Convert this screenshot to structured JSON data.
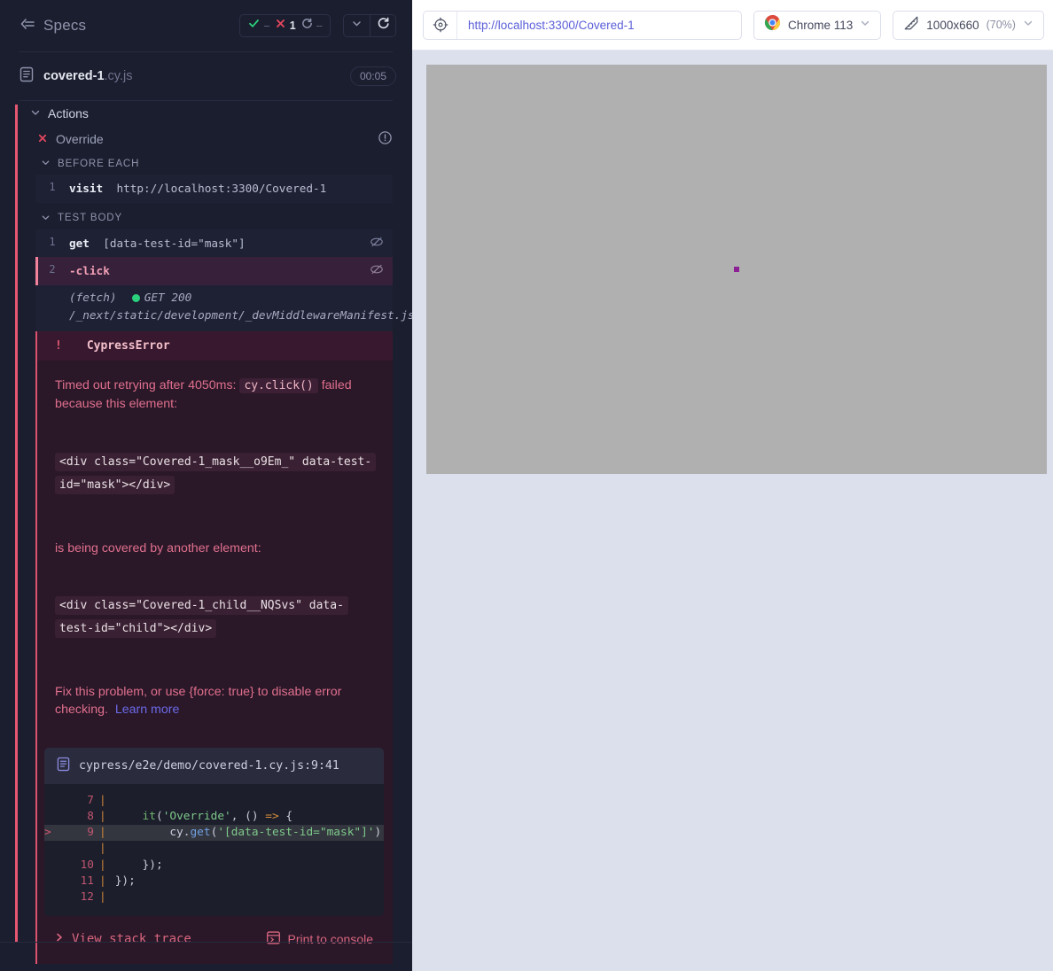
{
  "reporter": {
    "header": {
      "specs_label": "Specs",
      "back_icon": "collapse-left-icon",
      "stats": [
        {
          "icon": "check-icon",
          "name": "passed",
          "value": "--"
        },
        {
          "icon": "x-icon",
          "name": "failed",
          "value": "1"
        },
        {
          "icon": "pending-icon",
          "name": "pending",
          "value": "--"
        }
      ],
      "controls": [
        {
          "icon": "chevron-down-icon",
          "name": "toggle-specs-list"
        },
        {
          "icon": "reload-icon",
          "name": "rerun-tests"
        }
      ]
    },
    "spec": {
      "file_icon": "file-document-icon",
      "name": "covered-1",
      "extension": ".cy.js",
      "duration": "00:05"
    },
    "suite": {
      "title": "Actions",
      "chevron": "chevron-down-icon"
    },
    "test": {
      "title": "Override",
      "status_icon": "x-icon",
      "info_icon": "exclamation-circle-icon"
    },
    "hooks": [
      {
        "title": "BEFORE EACH",
        "chevron": "chevron-down-icon",
        "commands": [
          {
            "num": "1",
            "method": "visit",
            "arg": "http://localhost:3300/Covered-1",
            "hidden_icon": false,
            "active": false
          }
        ]
      },
      {
        "title": "TEST BODY",
        "chevron": "chevron-down-icon",
        "commands": [
          {
            "num": "1",
            "method": "get",
            "arg": "[data-test-id=\"mask\"]",
            "hidden_icon": true,
            "active": false
          },
          {
            "num": "2",
            "method": "-click",
            "arg": "",
            "hidden_icon": true,
            "active": true
          }
        ],
        "route": {
          "label": "(fetch)",
          "status_dot": "green",
          "status": "GET 200",
          "url": "/_next/static/development/_devMiddlewareManifest.json"
        }
      }
    ],
    "error": {
      "bang": "!",
      "name": "CypressError",
      "message_prefix": "Timed out retrying after 4050ms:",
      "message_code": "cy.click()",
      "message_suffix": "failed because this element:",
      "element_html": "<div class=\"Covered-1_mask__o9Em_\" data-test-id=\"mask\"></div>",
      "middle_text": "is being covered by another element:",
      "covering_html": "<div class=\"Covered-1_child__NQSvs\" data-test-id=\"child\"></div>",
      "fix_text": "Fix this problem, or use {force: true} to disable error checking.",
      "learn_more": "Learn more",
      "codeframe": {
        "file_icon": "file-document-icon",
        "path": "cypress/e2e/demo/covered-1.cy.js:9:41",
        "lines": [
          {
            "num": "7",
            "marker": "",
            "highlight": false,
            "code": ""
          },
          {
            "num": "8",
            "marker": "",
            "highlight": false,
            "code": "    it('Override', () => {"
          },
          {
            "num": "9",
            "marker": ">",
            "highlight": true,
            "code": "        cy.get('[data-test-id=\"mask\"]')"
          },
          {
            "num": "",
            "marker": "",
            "highlight": false,
            "code": ""
          },
          {
            "num": "10",
            "marker": "",
            "highlight": false,
            "code": "    });"
          },
          {
            "num": "11",
            "marker": "",
            "highlight": false,
            "code": "});"
          },
          {
            "num": "12",
            "marker": "",
            "highlight": false,
            "code": ""
          }
        ]
      },
      "actions": {
        "stack_trace": "View stack trace",
        "stack_trace_icon": "chevron-right-icon",
        "print_console": "Print to console",
        "print_console_icon": "console-window-icon"
      }
    }
  },
  "aut": {
    "toolbar": {
      "selector_icon": "selector-playground-icon",
      "url": "http://localhost:3300/Covered-1",
      "browser_icon": "chrome-icon",
      "browser": "Chrome 113",
      "browser_chevron": "chevron-down-icon",
      "viewport_icon": "ruler-icon",
      "viewport_size": "1000x660",
      "viewport_scale": "(70%)",
      "viewport_chevron": "chevron-down-icon"
    },
    "stage": {
      "mask_element": "mask-div",
      "child_element": "child-div"
    }
  },
  "colors": {
    "accent_fail": "#e45770",
    "accent_pass": "#2bd07c",
    "link": "#6b6ae8",
    "error_bg": "#2a1728",
    "panel_bg": "#1b1e2e"
  }
}
